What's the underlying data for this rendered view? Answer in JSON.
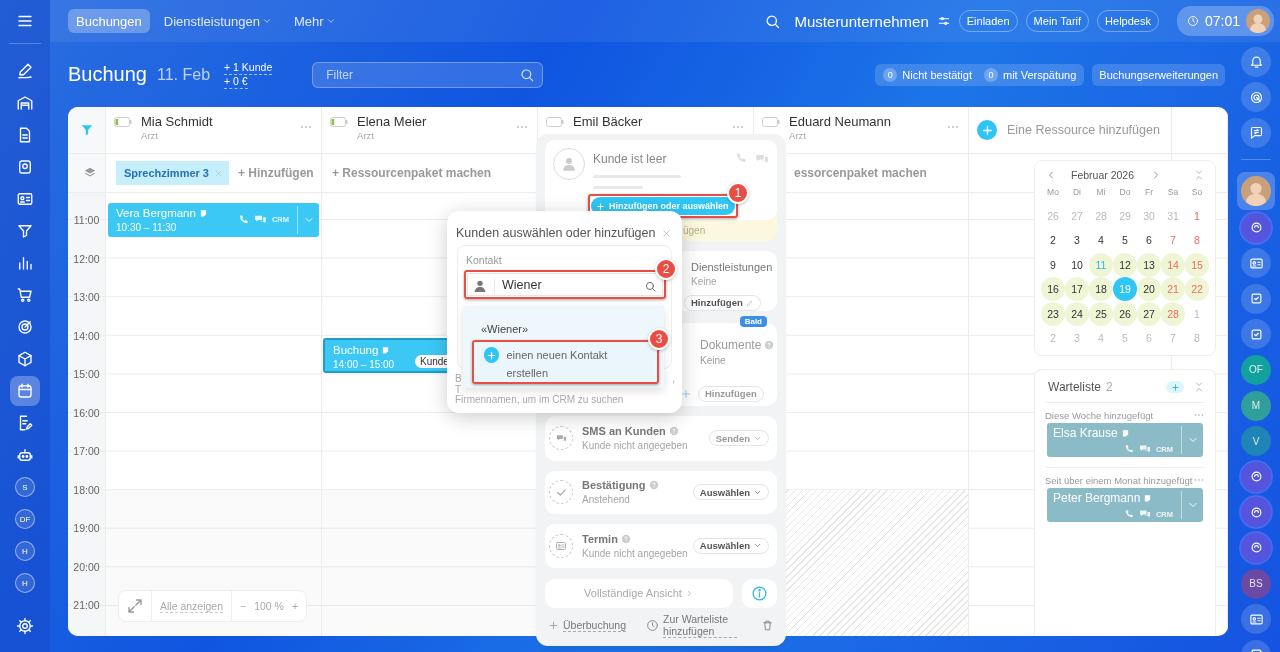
{
  "top_nav": {
    "tabs": [
      {
        "label": "Buchungen",
        "selected": true,
        "dropdown": false
      },
      {
        "label": "Dienstleistungen",
        "selected": false,
        "dropdown": true
      },
      {
        "label": "Mehr",
        "selected": false,
        "dropdown": true
      }
    ],
    "company": "Musterunternehmen",
    "links": [
      "Einladen",
      "Mein Tarif",
      "Helpdesk"
    ],
    "time": "07:01"
  },
  "left_nav": [
    {
      "kind": "icon",
      "selected": false
    },
    {
      "kind": "icon",
      "selected": false
    },
    {
      "kind": "icon",
      "selected": false
    },
    {
      "kind": "icon",
      "selected": false
    },
    {
      "kind": "icon",
      "selected": false
    },
    {
      "kind": "icon",
      "selected": false
    },
    {
      "kind": "icon",
      "selected": false
    },
    {
      "kind": "icon",
      "selected": false
    },
    {
      "kind": "icon",
      "selected": false
    },
    {
      "kind": "icon",
      "selected": false
    },
    {
      "kind": "icon",
      "selected": false
    },
    {
      "kind": "icon",
      "selected": true
    },
    {
      "kind": "icon",
      "selected": false
    },
    {
      "kind": "icon",
      "selected": false
    },
    {
      "kind": "avatar",
      "label": "S",
      "selected": false
    },
    {
      "kind": "avatar",
      "label": "DF",
      "selected": false
    },
    {
      "kind": "avatar",
      "label": "H",
      "selected": false
    },
    {
      "kind": "avatar",
      "label": "H",
      "selected": false
    },
    {
      "kind": "icon",
      "selected": false
    }
  ],
  "header": {
    "title": "Buchung",
    "date": "11. Feb",
    "stats": [
      "+ 1 Kunde",
      "+ 0 €"
    ],
    "filter": {
      "placeholder": "Filter"
    },
    "counters": [
      {
        "count": "0",
        "label": "Nicht bestätigt"
      },
      {
        "count": "0",
        "label": "mit Verspätung"
      }
    ],
    "extensions": "Buchungserweiterungen"
  },
  "board": {
    "resources": [
      {
        "name": "Mia Schmidt",
        "role": "Arzt",
        "level": 0.15,
        "evening_blocked": false,
        "bookings": [
          {
            "kind": "client",
            "title": "Vera Bergmann",
            "time": "10:30 – 11:30",
            "crm": "CRM"
          }
        ]
      },
      {
        "name": "Elena Meier",
        "role": "Arzt",
        "level": 0.15,
        "evening_blocked": false,
        "pack": "+ Ressourcenpaket machen",
        "bookings": [
          {
            "kind": "empty",
            "title": "Buchung",
            "time": "14:00 – 15:00",
            "tag": "Kunde"
          }
        ]
      },
      {
        "name": "Emil Bäcker",
        "level": 0,
        "evening_blocked": false
      },
      {
        "name": "Eduard Neumann",
        "role": "Arzt",
        "level": 0,
        "evening_blocked": true,
        "pack": "essorcenpaket machen"
      }
    ],
    "add_resource": "Eine Ressource hinzufügen",
    "group": {
      "tag": "Sprechzimmer 3",
      "add": "+ Hinzufügen"
    },
    "times": [
      "11:00",
      "12:00",
      "13:00",
      "14:00",
      "15:00",
      "16:00",
      "17:00",
      "18:00",
      "19:00",
      "20:00",
      "21:00"
    ],
    "zoom": {
      "show_all": "Alle anzeigen",
      "minus": "−",
      "value": "100 %",
      "plus": "+"
    }
  },
  "side": {
    "calendar": {
      "month": "Februar 2026",
      "weekdays": [
        "Mo",
        "Di",
        "Mi",
        "Do",
        "Fr",
        "Sa",
        "So"
      ],
      "weeks": [
        [
          {
            "d": "26",
            "kind": "outside",
            "selected": false
          },
          {
            "d": "27",
            "kind": "outside",
            "selected": false
          },
          {
            "d": "28",
            "kind": "outside",
            "selected": false
          },
          {
            "d": "29",
            "kind": "outside",
            "selected": false
          },
          {
            "d": "30",
            "kind": "outside",
            "selected": false
          },
          {
            "d": "31",
            "kind": "outside",
            "selected": false
          },
          {
            "d": "1",
            "kind": "weekend",
            "selected": false
          }
        ],
        [
          {
            "d": "2",
            "kind": "plain",
            "selected": false
          },
          {
            "d": "3",
            "kind": "plain",
            "selected": false
          },
          {
            "d": "4",
            "kind": "plain",
            "selected": false
          },
          {
            "d": "5",
            "kind": "plain",
            "selected": false
          },
          {
            "d": "6",
            "kind": "plain",
            "selected": false
          },
          {
            "d": "7",
            "kind": "weekend",
            "selected": false
          },
          {
            "d": "8",
            "kind": "weekend",
            "selected": false
          }
        ],
        [
          {
            "d": "9",
            "kind": "plain",
            "selected": false
          },
          {
            "d": "10",
            "kind": "plain",
            "selected": false
          },
          {
            "d": "11",
            "kind": "booked-current",
            "selected": false
          },
          {
            "d": "12",
            "kind": "booked",
            "selected": false
          },
          {
            "d": "13",
            "kind": "booked",
            "selected": false
          },
          {
            "d": "14",
            "kind": "booked-weekend",
            "selected": false
          },
          {
            "d": "15",
            "kind": "booked-weekend",
            "selected": false
          }
        ],
        [
          {
            "d": "16",
            "kind": "booked",
            "selected": false
          },
          {
            "d": "17",
            "kind": "booked",
            "selected": false
          },
          {
            "d": "18",
            "kind": "booked",
            "selected": false
          },
          {
            "d": "19",
            "kind": "booked",
            "selected": true
          },
          {
            "d": "20",
            "kind": "booked",
            "selected": false
          },
          {
            "d": "21",
            "kind": "booked-weekend",
            "selected": false
          },
          {
            "d": "22",
            "kind": "booked-weekend",
            "selected": false
          }
        ],
        [
          {
            "d": "23",
            "kind": "booked",
            "selected": false
          },
          {
            "d": "24",
            "kind": "booked",
            "selected": false
          },
          {
            "d": "25",
            "kind": "booked",
            "selected": false
          },
          {
            "d": "26",
            "kind": "booked",
            "selected": false
          },
          {
            "d": "27",
            "kind": "booked",
            "selected": false
          },
          {
            "d": "28",
            "kind": "booked-weekend",
            "selected": false
          },
          {
            "d": "1",
            "kind": "outside",
            "selected": false
          }
        ],
        [
          {
            "d": "2",
            "kind": "outside",
            "selected": false
          },
          {
            "d": "3",
            "kind": "outside",
            "selected": false
          },
          {
            "d": "4",
            "kind": "outside",
            "selected": false
          },
          {
            "d": "5",
            "kind": "outside",
            "selected": false
          },
          {
            "d": "6",
            "kind": "outside",
            "selected": false
          },
          {
            "d": "7",
            "kind": "outside",
            "selected": false
          },
          {
            "d": "8",
            "kind": "outside",
            "selected": false
          }
        ]
      ]
    },
    "waitlist": {
      "title": "Warteliste",
      "count": "2",
      "groups": [
        {
          "label": "Diese Woche hinzugefügt",
          "entries": [
            {
              "name": "Elsa Krause",
              "crm": "CRM"
            }
          ]
        },
        {
          "label": "Seit über einem Monat hinzugefügt",
          "entries": [
            {
              "name": "Peter Bergmann",
              "crm": "CRM"
            }
          ]
        }
      ]
    }
  },
  "right_nav": [
    {
      "kind": "icon",
      "selected": false
    },
    {
      "kind": "icon",
      "selected": false
    },
    {
      "kind": "icon",
      "selected": false
    },
    {
      "kind": "photo",
      "selected": true
    },
    {
      "kind": "icon",
      "selected": false
    },
    {
      "kind": "icon",
      "selected": false
    },
    {
      "kind": "icon",
      "selected": false
    },
    {
      "kind": "icon",
      "selected": false
    },
    {
      "kind": "avatar",
      "label": "OF",
      "color": "#12a19e",
      "selected": false
    },
    {
      "kind": "avatar",
      "label": "M",
      "color": "#2f9f9b",
      "selected": false
    },
    {
      "kind": "avatar",
      "label": "V",
      "color": "#1f84b6",
      "selected": false
    },
    {
      "kind": "icon",
      "selected": false
    },
    {
      "kind": "icon",
      "selected": false
    },
    {
      "kind": "icon",
      "selected": false
    },
    {
      "kind": "avatar",
      "label": "BS",
      "color": "#6a4aa5",
      "selected": false
    },
    {
      "kind": "icon",
      "selected": false
    },
    {
      "kind": "icon",
      "selected": false
    }
  ],
  "booking_card": {
    "customer": {
      "title": "Kunde ist leer",
      "button": {
        "label": "Hinzufügen oder auswählen",
        "step": "1"
      },
      "hint": "ügen"
    },
    "sections": [
      {
        "kind": "services",
        "title": "Dienstleistungen",
        "help": false,
        "value": "Keine",
        "action": "Hinzufügen",
        "disabled": false
      },
      {
        "kind": "documents",
        "title": "Dokumente",
        "help": true,
        "value": "Keine",
        "action": "Hinzufügen",
        "disabled": true,
        "badge": "Bald"
      },
      {
        "kind": "sms",
        "title": "SMS an Kunden",
        "help": true,
        "value": "Kunde nicht angegeben",
        "action": "Senden",
        "disabled": true
      },
      {
        "kind": "confirmation",
        "title": "Bestätigung",
        "help": true,
        "value": "Anstehend",
        "action": "Auswählen",
        "disabled": false
      },
      {
        "kind": "appointment",
        "title": "Termin",
        "help": true,
        "value": "Kunde nicht angegeben",
        "action": "Auswählen",
        "disabled": false
      }
    ],
    "full_view": "Vollständige Ansicht",
    "actions": [
      {
        "kind": "overbooking",
        "label": "Überbuchung"
      },
      {
        "kind": "waitlist",
        "label": "Zur Warteliste hinzufügen"
      },
      {
        "kind": "delete"
      }
    ]
  },
  "customer_dialog": {
    "title": "Kunden auswählen oder hinzufügen",
    "field_label": "Kontakt",
    "search": {
      "value": "Wiener",
      "step": "2"
    },
    "suggestions": [
      {
        "kind": "query",
        "label": "«Wiener»"
      },
      {
        "kind": "create",
        "label": "einen neuen Kontakt erstellen",
        "step": "3"
      }
    ],
    "help": [
      "B",
      "T",
      "Firmennamen, um im CRM zu suchen"
    ],
    "help_tail": ","
  }
}
